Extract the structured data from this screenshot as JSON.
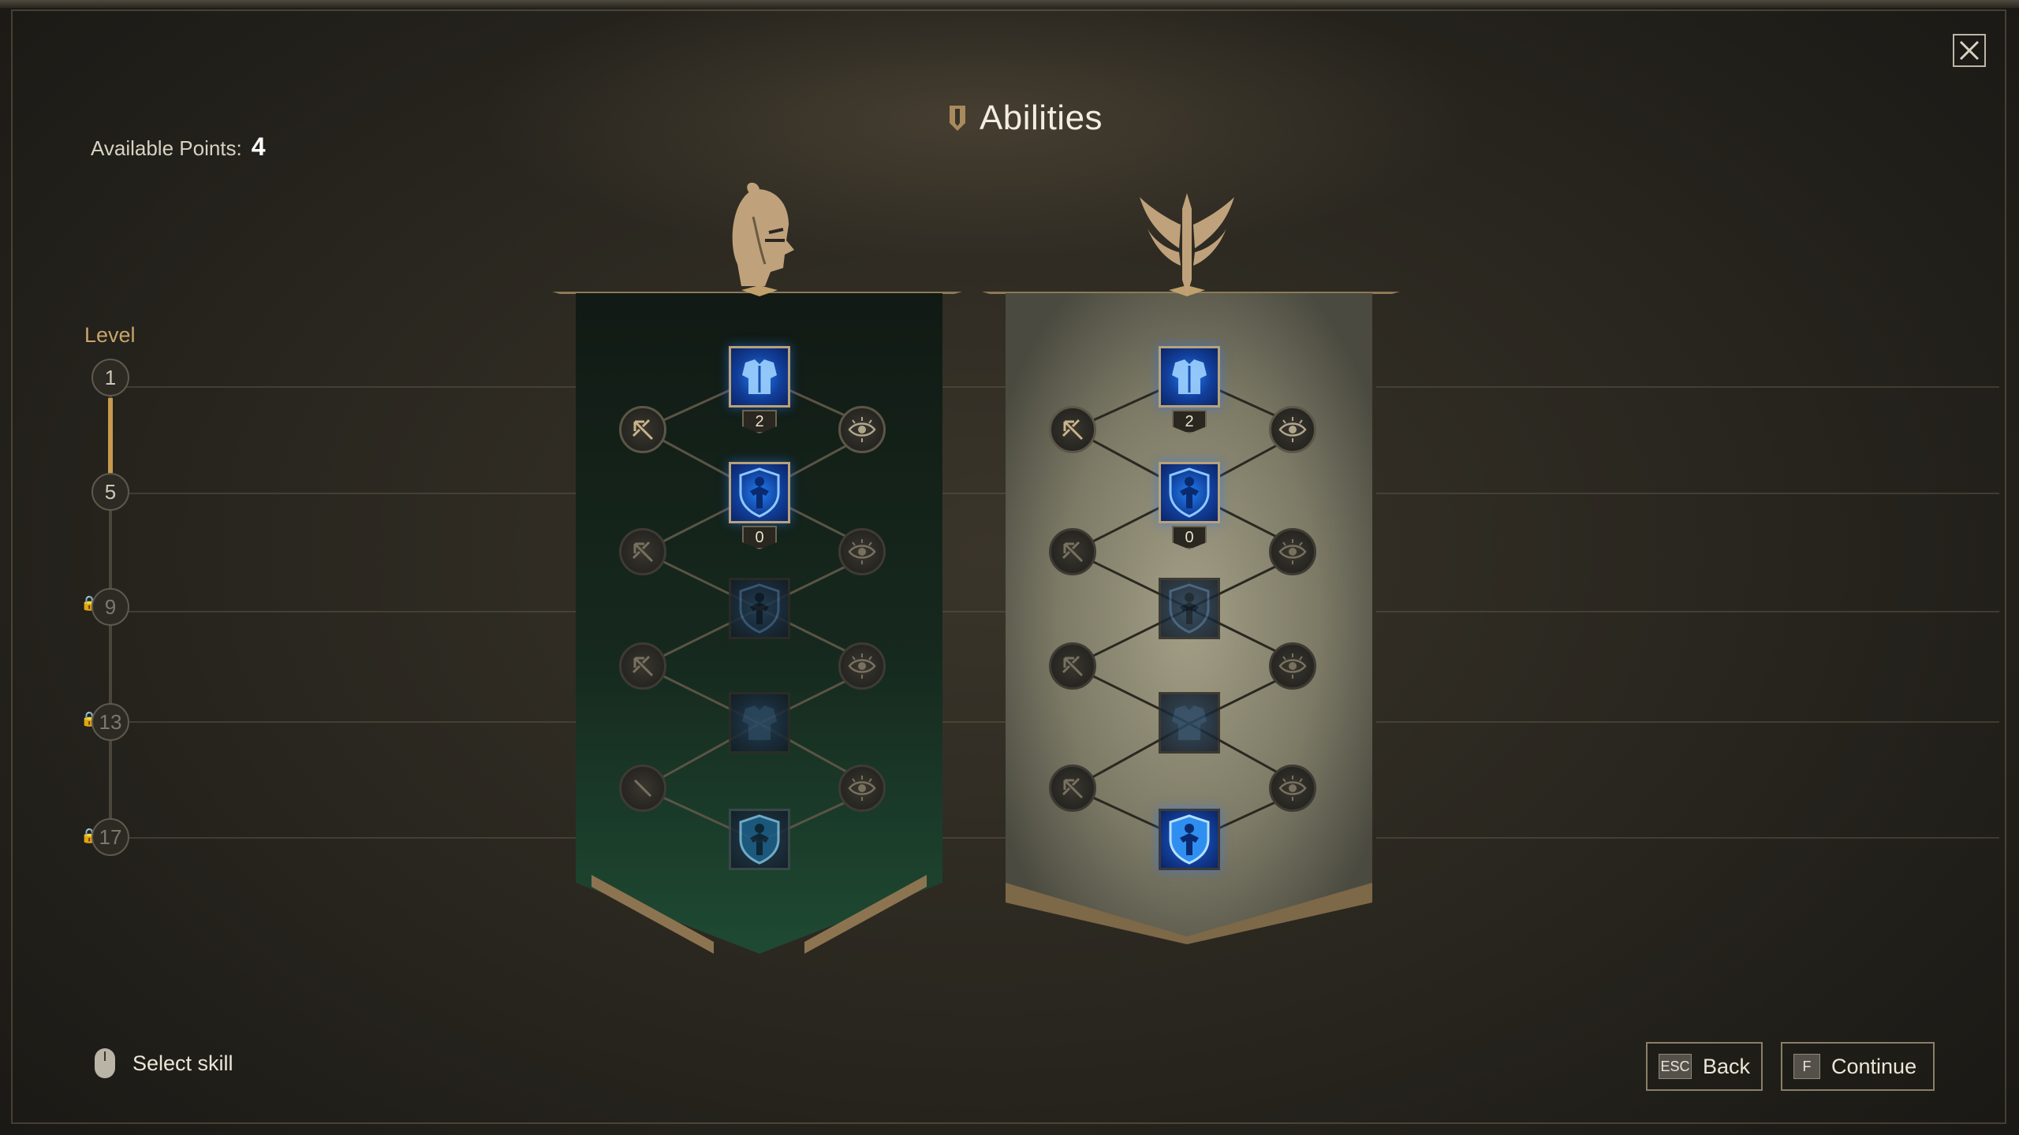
{
  "header": {
    "title": "Abilities"
  },
  "points": {
    "label": "Available Points:",
    "value": "4"
  },
  "levels": {
    "label": "Level",
    "nodes": [
      "1",
      "5",
      "9",
      "13",
      "17"
    ],
    "locked": [
      false,
      false,
      true,
      true,
      true
    ],
    "progress_fraction": 0.25
  },
  "trees": [
    {
      "name": "character-tree",
      "emblem": "warrior-head-icon",
      "counts": [
        "2",
        "0"
      ],
      "theme": "#183325"
    },
    {
      "name": "weapon-tree",
      "emblem": "winged-sword-icon",
      "counts": [
        "2",
        "0"
      ],
      "theme": "#86836f"
    }
  ],
  "footer": {
    "hint": "Select skill",
    "back": {
      "key": "ESC",
      "label": "Back"
    },
    "continue": {
      "key": "F",
      "label": "Continue"
    }
  },
  "colors": {
    "accent": "#c79a4e",
    "skill_blue": "#1f7df0"
  }
}
